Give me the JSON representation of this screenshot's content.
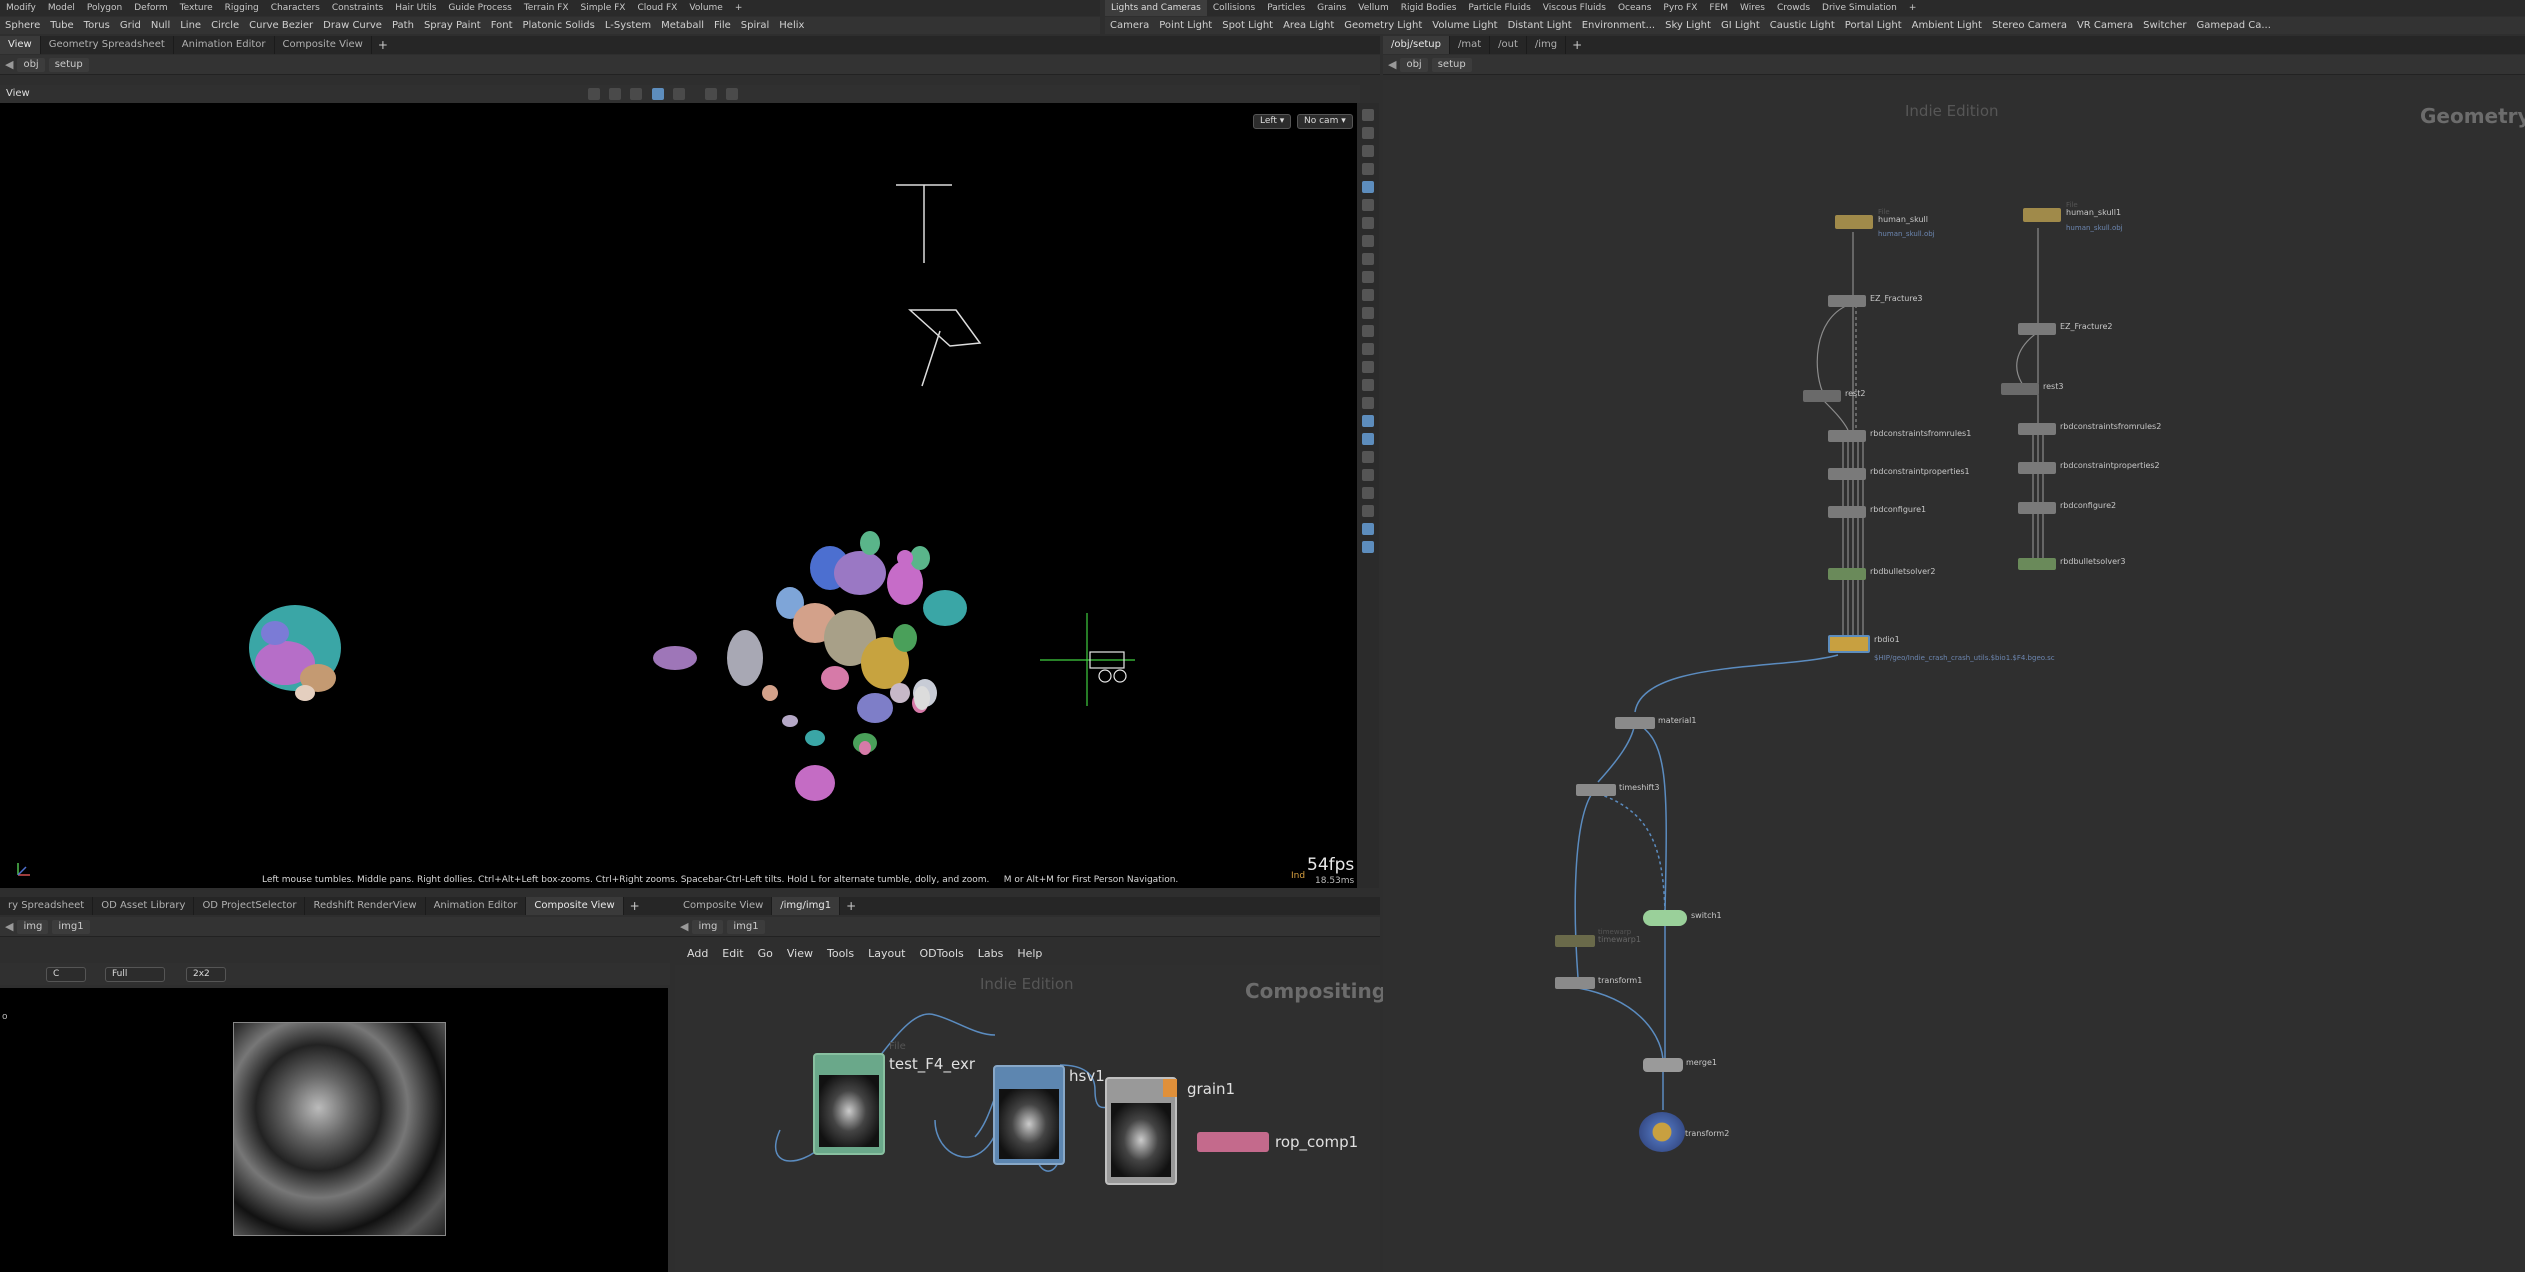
{
  "shelf_left": {
    "tabs": [
      "Modify",
      "Model",
      "Polygon",
      "Deform",
      "Texture",
      "Rigging",
      "Characters",
      "Constraints",
      "Hair Utils",
      "Guide Process",
      "Terrain FX",
      "Simple FX",
      "Cloud FX",
      "Volume",
      "+"
    ],
    "tools": [
      "Sphere",
      "Tube",
      "Torus",
      "Grid",
      "Null",
      "Line",
      "Circle",
      "Curve Bezier",
      "Draw Curve",
      "Path",
      "Spray Paint",
      "Font",
      "Platonic Solids",
      "L-System",
      "Metaball",
      "File",
      "Spiral",
      "Helix"
    ]
  },
  "shelf_right": {
    "tabs": [
      "Lights and Cameras",
      "Collisions",
      "Particles",
      "Grains",
      "Vellum",
      "Rigid Bodies",
      "Particle Fluids",
      "Viscous Fluids",
      "Oceans",
      "Pyro FX",
      "FEM",
      "Wires",
      "Crowds",
      "Drive Simulation",
      "+"
    ],
    "tools": [
      "Camera",
      "Point Light",
      "Spot Light",
      "Area Light",
      "Geometry Light",
      "Volume Light",
      "Distant Light",
      "Environment...",
      "Sky Light",
      "GI Light",
      "Caustic Light",
      "Portal Light",
      "Ambient Light",
      "Stereo Camera",
      "VR Camera",
      "Switcher",
      "Gamepad Ca..."
    ]
  },
  "top_left_tabs": [
    "View",
    "Geometry Spreadsheet",
    "Animation Editor",
    "Composite View"
  ],
  "top_left_path": {
    "net": "obj",
    "node": "setup"
  },
  "viewport": {
    "title": "View",
    "view_menu": "Left ▾",
    "cam_menu": "No cam ▾",
    "hint": "Left mouse tumbles. Middle pans. Right dollies. Ctrl+Alt+Left box-zooms. Ctrl+Right zooms. Spacebar-Ctrl-Left tilts. Hold L for alternate tumble, dolly, and zoom.     M or Alt+M for First Person Navigation.",
    "fps": "54fps",
    "ms": "18.53ms",
    "corner_label": "Ind"
  },
  "bottom_left_tabs": [
    "ry Spreadsheet",
    "OD Asset Library",
    "OD ProjectSelector",
    "Redshift RenderView",
    "Animation Editor",
    "Composite View"
  ],
  "bottom_left_path": {
    "net": "img",
    "node": "img1"
  },
  "image_viewer": {
    "channel": "C",
    "res": "Full",
    "grid": "2x2",
    "corner_text": "o"
  },
  "comp_tabs": [
    "Composite View",
    "/img/img1"
  ],
  "comp_path": {
    "net": "img",
    "node": "img1"
  },
  "comp_menu": [
    "Add",
    "Edit",
    "Go",
    "View",
    "Tools",
    "Layout",
    "ODTools",
    "Labs",
    "Help"
  ],
  "comp_watermark": "Indie Edition",
  "comp_context": "Compositing",
  "comp_nodes": {
    "file_type": "File",
    "file_name": "test_F4_exr",
    "hsv": "hsv1",
    "grain": "grain1",
    "rop": "rop_comp1"
  },
  "right_tabs": [
    "/obj/setup",
    "/mat",
    "/out",
    "/img"
  ],
  "right_path": {
    "net": "obj",
    "node": "setup"
  },
  "net_watermark": "Indie Edition",
  "net_context": "Geometry",
  "net_nodes": {
    "file1_type": "File",
    "file1_name": "human_skull",
    "file1_sub": "human_skull.obj",
    "file2_type": "File",
    "file2_name": "human_skull1",
    "file2_sub": "human_skull.obj",
    "ez1": "EZ_Fracture3",
    "ez2": "EZ_Fracture2",
    "rest1": "rest2",
    "rest2": "rest3",
    "cfr1": "rbdconstraintsfromrules1",
    "cfr2": "rbdconstraintsfromrules2",
    "cp1": "rbdconstraintproperties1",
    "cp2": "rbdconstraintproperties2",
    "conf1": "rbdconfigure1",
    "conf2": "rbdconfigure2",
    "solver1": "rbdbulletsolver2",
    "solver2": "rbdbulletsolver3",
    "io": "rbdio1",
    "io_sub": "$HIP/geo/Indie_crash_crash_utils.$bio1.$F4.bgeo.sc",
    "material": "material1",
    "timeshift": "timeshift3",
    "switch": "switch1",
    "timewarp_type": "timewarp",
    "timewarp": "timewarp1",
    "transform1": "transform1",
    "merge": "merge1",
    "transform2": "transform2"
  }
}
